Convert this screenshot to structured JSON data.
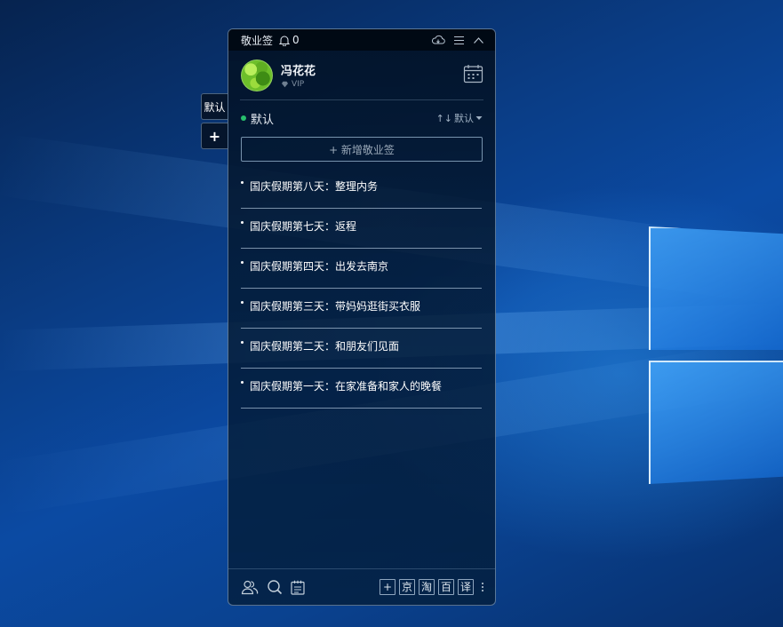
{
  "app": {
    "title": "敬业签",
    "notification_count": "0"
  },
  "user": {
    "name": "冯花花",
    "badge": "VIP"
  },
  "side_tabs": [
    {
      "label": "默认"
    },
    {
      "label": "+"
    }
  ],
  "list": {
    "name": "默认",
    "sort_label": "默认",
    "sort_icon": "↑↓",
    "add_note_label": "+ 新增敬业签"
  },
  "notes": [
    {
      "text": "国庆假期第八天：整理内务"
    },
    {
      "text": "国庆假期第七天：返程"
    },
    {
      "text": "国庆假期第四天：出发去南京"
    },
    {
      "text": "国庆假期第三天：带妈妈逛街买衣服"
    },
    {
      "text": "国庆假期第二天：和朋友们见面"
    },
    {
      "text": "国庆假期第一天：在家准备和家人的晚餐"
    }
  ],
  "bottom_toolbar": {
    "left_icons": [
      "contacts-icon",
      "search-icon",
      "notepad-icon"
    ],
    "quick_buttons": [
      {
        "label": "+"
      },
      {
        "label": "京"
      },
      {
        "label": "淘"
      },
      {
        "label": "百"
      },
      {
        "label": "译"
      }
    ]
  },
  "colors": {
    "status_dot": "#27c06d",
    "window_bg": "#041a34"
  }
}
